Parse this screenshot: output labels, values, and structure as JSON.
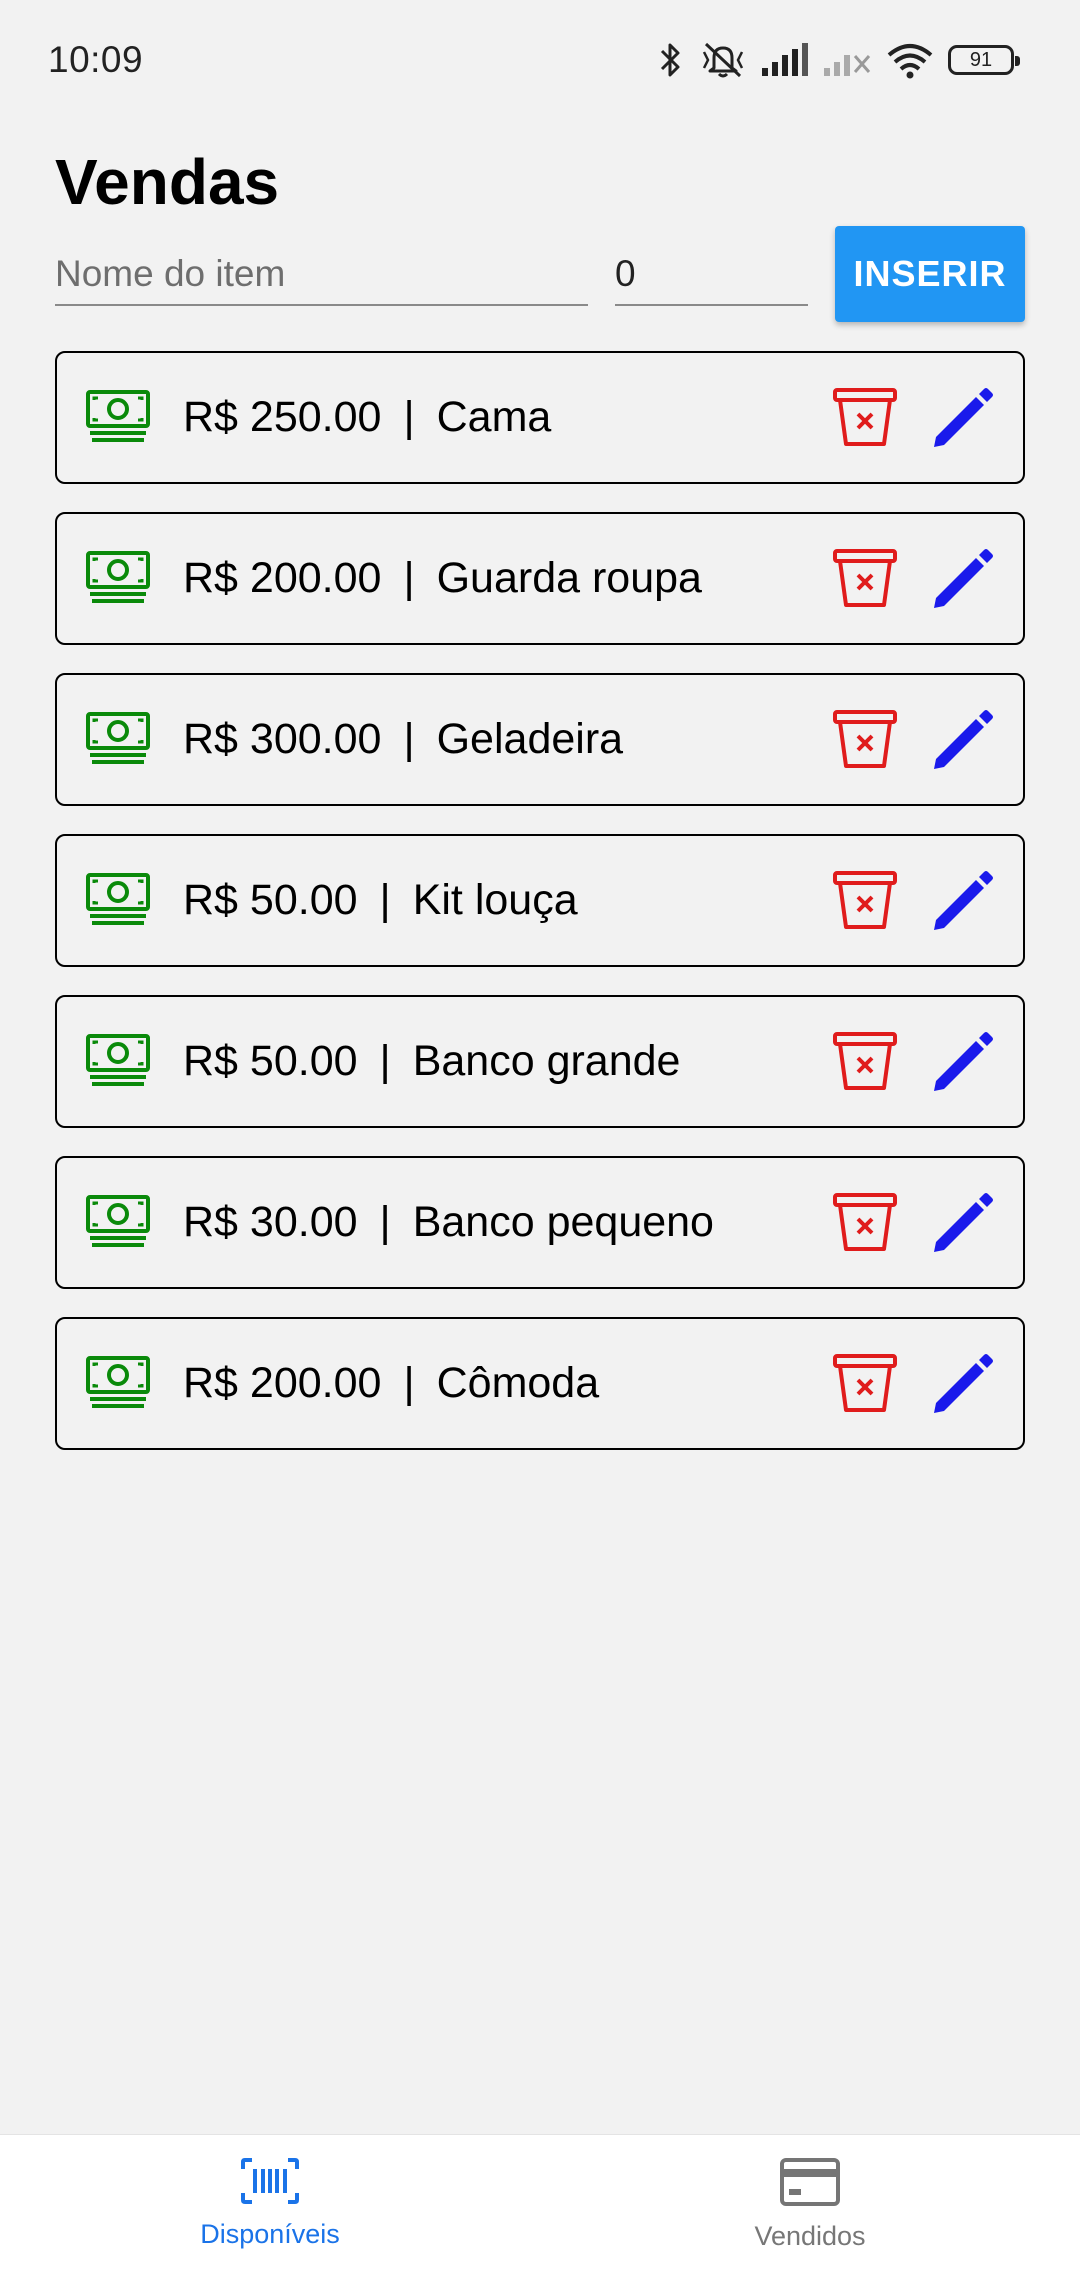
{
  "status_bar": {
    "time": "10:09",
    "battery": "91",
    "icons": [
      "bluetooth-icon",
      "silent-icon",
      "signal-icon",
      "signal-no-service-icon",
      "wifi-icon",
      "battery-icon"
    ]
  },
  "header": {
    "title": "Vendas"
  },
  "form": {
    "name_placeholder": "Nome do item",
    "quantity_value": "0",
    "insert_label": "INSERIR"
  },
  "colors": {
    "money": "#0a8a0a",
    "delete": "#e01c1c",
    "edit": "#1a1aeb",
    "accent": "#2196f3",
    "nav_active": "#1a73e8"
  },
  "items": [
    {
      "price": "R$ 250.00",
      "separator": "|",
      "name": "Cama"
    },
    {
      "price": "R$ 200.00",
      "separator": "|",
      "name": "Guarda roupa"
    },
    {
      "price": "R$ 300.00",
      "separator": "|",
      "name": "Geladeira"
    },
    {
      "price": "R$ 50.00",
      "separator": "|",
      "name": "Kit louça"
    },
    {
      "price": "R$ 50.00",
      "separator": "|",
      "name": "Banco grande"
    },
    {
      "price": "R$ 30.00",
      "separator": "|",
      "name": "Banco pequeno"
    },
    {
      "price": "R$ 200.00",
      "separator": "|",
      "name": "Cômoda"
    }
  ],
  "bottom_nav": {
    "tabs": [
      {
        "label": "Disponíveis",
        "icon": "barcode-icon",
        "active": true
      },
      {
        "label": "Vendidos",
        "icon": "card-icon",
        "active": false
      }
    ]
  }
}
